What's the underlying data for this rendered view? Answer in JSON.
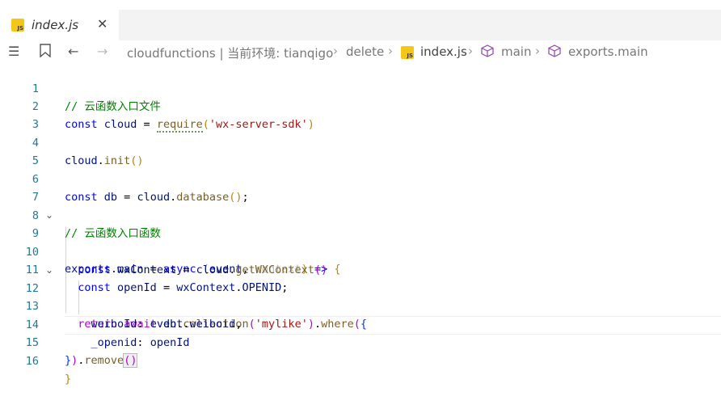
{
  "tab": {
    "title": "index.js",
    "icon": "js-file-icon",
    "close_glyph": "✕"
  },
  "breadcrumb": {
    "items": [
      "cloudfunctions | 当前环境: tianqigo",
      "delete",
      "index.js",
      "main",
      "exports.main"
    ]
  },
  "code": {
    "line_numbers": [
      "1",
      "2",
      "3",
      "4",
      "5",
      "6",
      "7",
      "8",
      "9",
      "10",
      "11",
      "12",
      "13",
      "14",
      "15",
      "16"
    ],
    "l1": "// 云函数入口文件",
    "l2a": "const",
    "l2b": "cloud",
    "l2c": "require",
    "l2d": "'wx-server-sdk'",
    "l4a": "cloud",
    "l4b": "init",
    "l6a": "const",
    "l6b": "db",
    "l6c": "cloud",
    "l6d": "database",
    "l8": "// 云函数入口函数",
    "l9a": "exports",
    "l9b": "main",
    "l9c": "async",
    "l9d": "event",
    "l9e": "context",
    "l10a": "const",
    "l10b": "wxContext",
    "l10c": "cloud",
    "l10d": "getWXContext",
    "l11a": "const",
    "l11b": "openId",
    "l11c": "wxContext",
    "l11d": "OPENID",
    "l12a": "return",
    "l12b": "await",
    "l12c": "db",
    "l12d": "collection",
    "l12e": "'mylike'",
    "l12f": "where",
    "l13a": "weiboId",
    "l13b": "event",
    "l13c": "weiboid",
    "l14a": "_openid",
    "l14b": "openId",
    "l15a": "remove"
  }
}
